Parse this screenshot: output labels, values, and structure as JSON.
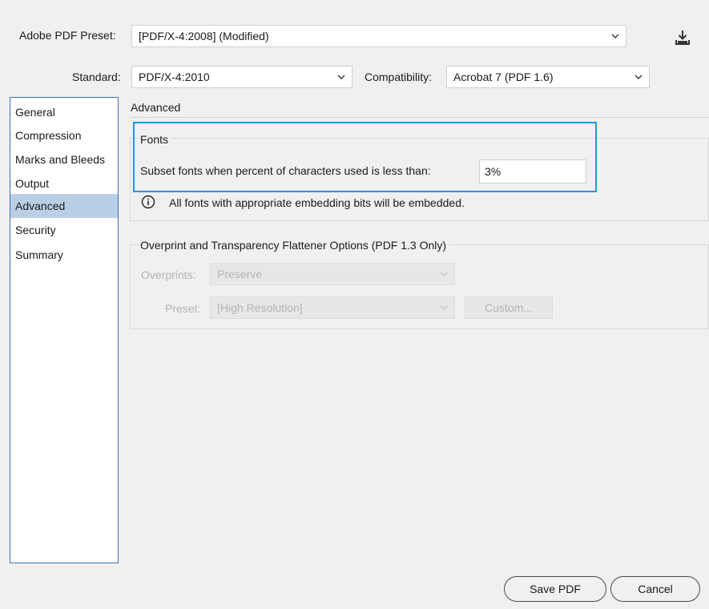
{
  "header": {
    "preset_label": "Adobe PDF Preset:",
    "preset_value": "[PDF/X-4:2008] (Modified)",
    "standard_label": "Standard:",
    "standard_value": "PDF/X-4:2010",
    "compat_label": "Compatibility:",
    "compat_value": "Acrobat 7 (PDF 1.6)",
    "save_preset_icon": "download-icon"
  },
  "sidebar": {
    "items": [
      {
        "label": "General",
        "selected": false
      },
      {
        "label": "Compression",
        "selected": false
      },
      {
        "label": "Marks and Bleeds",
        "selected": false
      },
      {
        "label": "Output",
        "selected": false
      },
      {
        "label": "Advanced",
        "selected": true
      },
      {
        "label": "Security",
        "selected": false
      },
      {
        "label": "Summary",
        "selected": false
      }
    ]
  },
  "main": {
    "section_title": "Advanced",
    "fonts": {
      "title": "Fonts",
      "subset_label": "Subset fonts when percent of characters used is less than:",
      "subset_value": "3%",
      "info_text": "All fonts with appropriate embedding bits will be embedded.",
      "info_icon": "info-icon"
    },
    "overprint": {
      "title": "Overprint and Transparency Flattener Options (PDF 1.3 Only)",
      "overprints_label": "Overprints:",
      "overprints_value": "Preserve",
      "preset_label": "Preset:",
      "preset_value": "[High Resolution]",
      "custom_label": "Custom..."
    }
  },
  "footer": {
    "save_label": "Save PDF",
    "cancel_label": "Cancel"
  },
  "colors": {
    "highlight": "#1b9ad6",
    "sidebar_border": "#3d6fb8",
    "selected_bg": "#b9cfe6"
  }
}
